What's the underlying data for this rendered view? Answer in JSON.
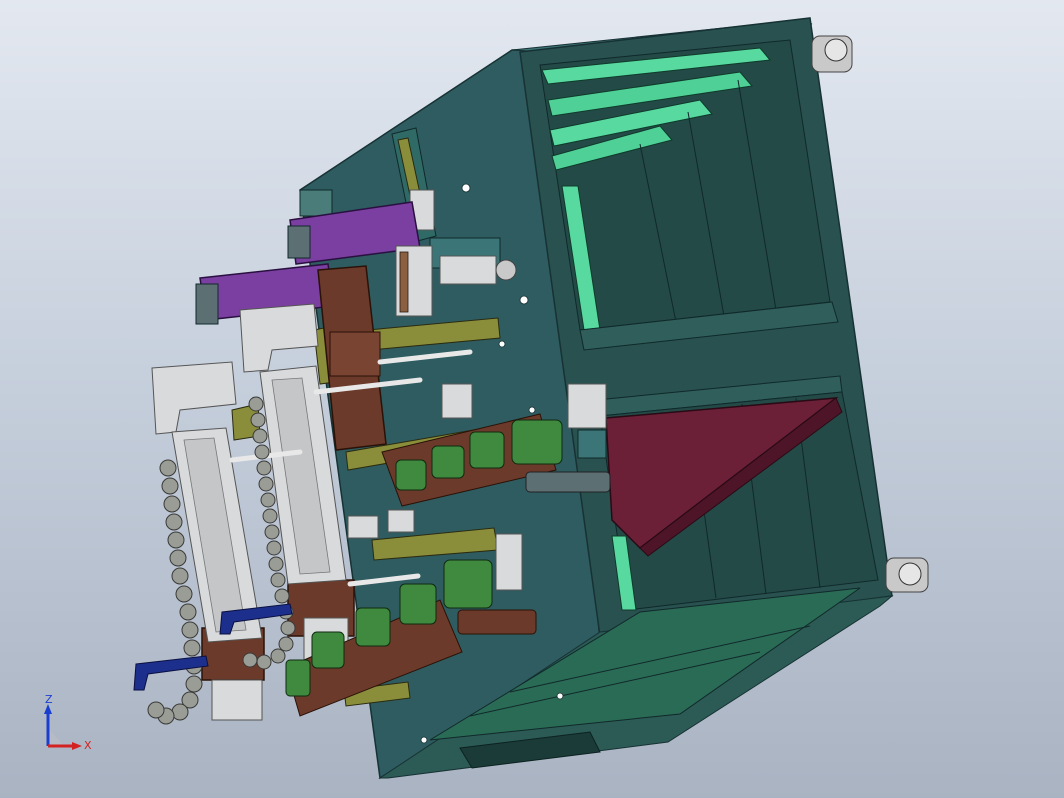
{
  "viewport": {
    "background_top": "#e3e8f0",
    "background_bottom": "#a9b3c2"
  },
  "palette": {
    "frame_teal": "#2e5c60",
    "frame_dark": "#1f4447",
    "panel_green": "#57d9a0",
    "panel_green_dark": "#1e5a45",
    "hopper_maroon": "#6b2038",
    "actuator_white": "#d8dadc",
    "bracket_olive": "#8a8e3a",
    "purple_block": "#7a3fa0",
    "brown_block": "#6b3a2a",
    "coil_green": "#3f8a3f",
    "cable_blue": "#1d2f8c",
    "chain_grey": "#9a9c96"
  },
  "triad": {
    "z_label": "Z",
    "x_label": "X",
    "z_color": "#1a3fd0",
    "x_color": "#d22222"
  }
}
